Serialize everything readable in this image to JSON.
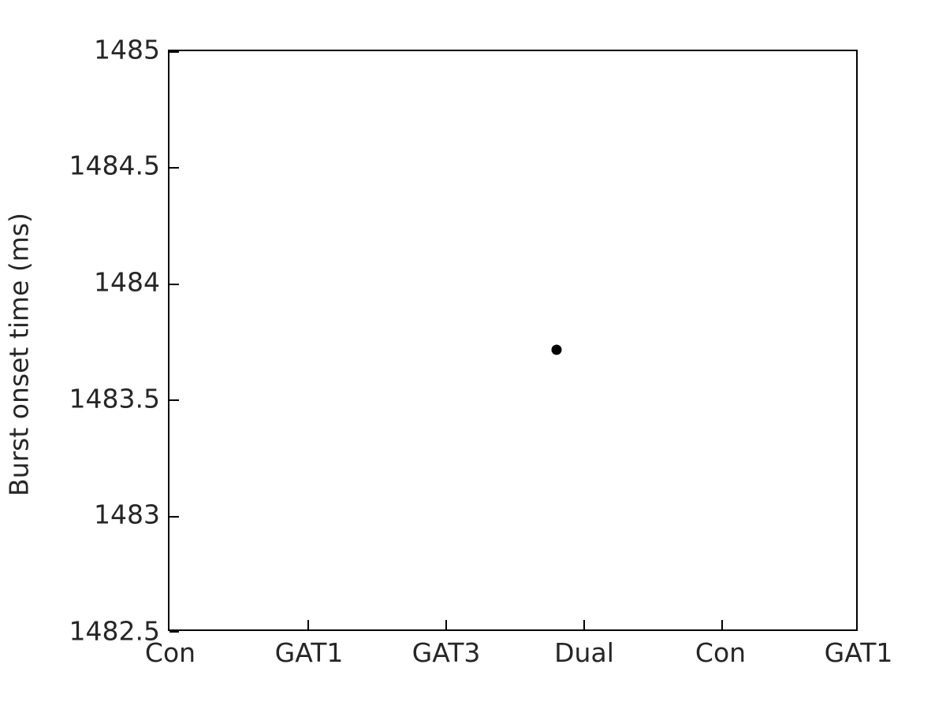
{
  "chart_data": {
    "type": "scatter",
    "title": "",
    "xlabel": "",
    "ylabel": "Burst onset time (ms)",
    "grid": false,
    "legend": null,
    "categories": [
      "Con",
      "GAT1",
      "GAT3",
      "Dual",
      "Con",
      "GAT1"
    ],
    "xtick_labels": [
      "Con",
      "GAT1",
      "GAT3",
      "Dual",
      "Con",
      "GAT1"
    ],
    "xtick_positions": [
      0,
      1,
      2,
      3,
      4,
      5
    ],
    "xlim": [
      0,
      5
    ],
    "ytick_labels": [
      "1485",
      "1484.5",
      "1484",
      "1483.5",
      "1483",
      "1482.5"
    ],
    "ytick_values": [
      1485,
      1484.5,
      1484,
      1483.5,
      1483,
      1482.5
    ],
    "ylim": [
      1482.5,
      1485
    ],
    "points": [
      {
        "x": 2.82,
        "y": 1483.71,
        "category": "Dual",
        "label": ""
      }
    ],
    "series": [
      {
        "name": "burst onset time",
        "marker": "circle",
        "color": "#000000",
        "x": [
          2.82
        ],
        "y": [
          1483.71
        ]
      }
    ],
    "marker_color": "#000000",
    "axis_color": "#000000",
    "background_color": "#ffffff",
    "text_color": "#262626"
  }
}
